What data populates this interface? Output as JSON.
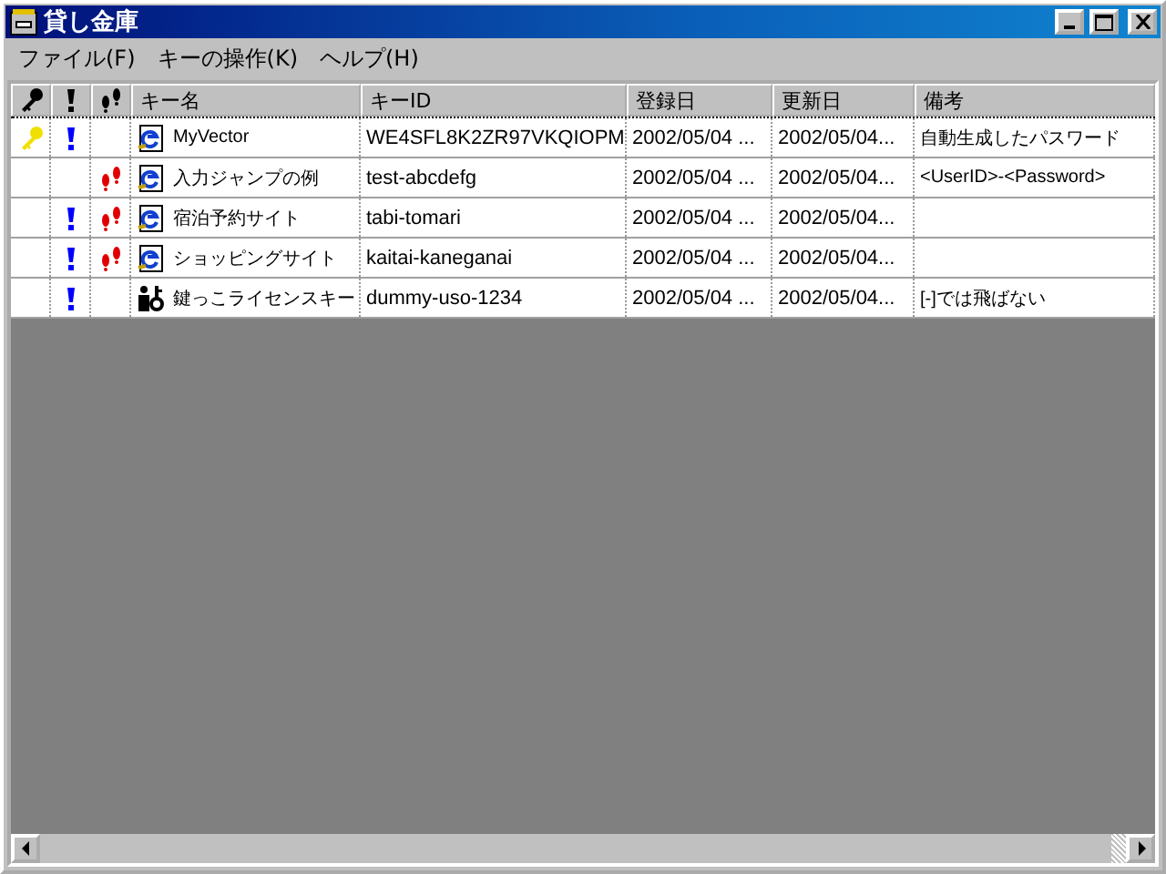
{
  "window": {
    "title": "貸し金庫"
  },
  "menu": [
    "ファイル(F)",
    "キーの操作(K)",
    "ヘルプ(H)"
  ],
  "columns": [
    "キー名",
    "キーID",
    "登録日",
    "更新日",
    "備考"
  ],
  "rows": [
    {
      "key": true,
      "important": true,
      "jump": false,
      "kind": "web",
      "focused": true,
      "name": "MyVector",
      "id": "WE4SFL8K2ZR97VKQIOPM",
      "registered": "2002/05/04 ...",
      "updated": "2002/05/04...",
      "note": "自動生成したパスワード"
    },
    {
      "key": false,
      "important": false,
      "jump": true,
      "kind": "web",
      "focused": false,
      "name": "入力ジャンプの例",
      "id": "test-abcdefg",
      "registered": "2002/05/04 ...",
      "updated": "2002/05/04...",
      "note": "<UserID>-<Password>"
    },
    {
      "key": false,
      "important": true,
      "jump": true,
      "kind": "web",
      "focused": false,
      "name": "宿泊予約サイト",
      "id": "tabi-tomari",
      "registered": "2002/05/04 ...",
      "updated": "2002/05/04...",
      "note": ""
    },
    {
      "key": false,
      "important": true,
      "jump": true,
      "kind": "web",
      "focused": false,
      "name": "ショッピングサイト",
      "id": "kaitai-kaneganai",
      "registered": "2002/05/04 ...",
      "updated": "2002/05/04...",
      "note": ""
    },
    {
      "key": false,
      "important": true,
      "jump": false,
      "kind": "license",
      "focused": false,
      "name": "鍵っこライセンスキー",
      "id": "dummy-uso-1234",
      "registered": "2002/05/04 ...",
      "updated": "2002/05/04...",
      "note": "[-]では飛ばない"
    }
  ]
}
